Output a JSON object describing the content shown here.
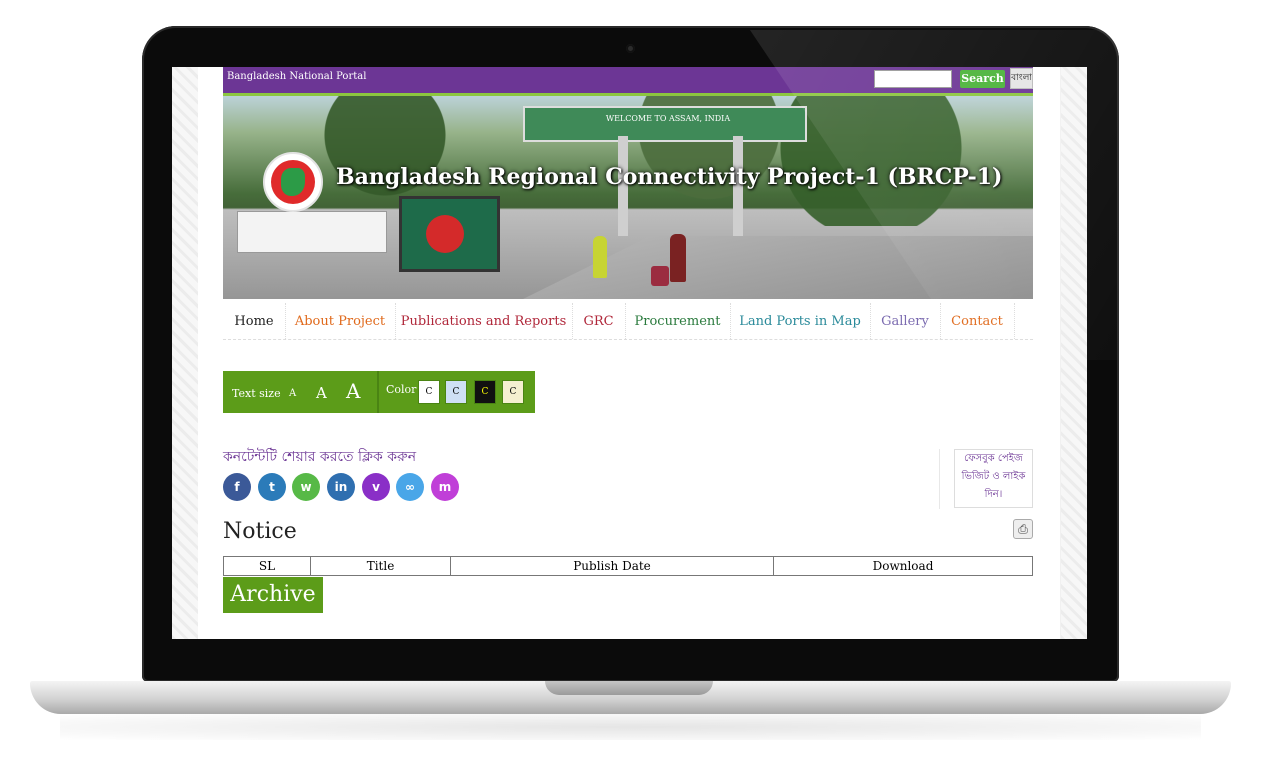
{
  "topbar": {
    "portal_label": "Bangladesh National Portal",
    "search_placeholder": "",
    "search_button": "Search",
    "lang_button": "বাংলা"
  },
  "banner": {
    "title": "Bangladesh Regional Connectivity Project-1 (BRCP-1)",
    "gate_text": "WELCOME TO ASSAM, INDIA"
  },
  "nav": {
    "items": [
      {
        "label": "Home",
        "color": "#222222"
      },
      {
        "label": "About Project",
        "color": "#e0691b"
      },
      {
        "label": "Publications and Reports",
        "color": "#b0273a"
      },
      {
        "label": "GRC",
        "color": "#b0273a"
      },
      {
        "label": "Procurement",
        "color": "#2a7a3d"
      },
      {
        "label": "Land Ports in Map",
        "color": "#2a8a9a"
      },
      {
        "label": "Gallery",
        "color": "#7b6bb0"
      },
      {
        "label": "Contact",
        "color": "#e0691b"
      }
    ]
  },
  "accessibility": {
    "text_size_label": "Text size",
    "size_small": "A",
    "size_medium": "A",
    "size_large": "A",
    "color_label": "Color",
    "swatches": [
      {
        "label": "C",
        "bg": "#ffffff",
        "fg": "#000000"
      },
      {
        "label": "C",
        "bg": "#cfe0f5",
        "fg": "#000000"
      },
      {
        "label": "C",
        "bg": "#111111",
        "fg": "#ffff00"
      },
      {
        "label": "C",
        "bg": "#f5f0d0",
        "fg": "#000000"
      }
    ]
  },
  "share": {
    "label": "কনটেন্টটি শেয়ার করতে ক্লিক করুন",
    "buttons": [
      {
        "icon": "facebook-icon",
        "glyph": "f",
        "color": "#3b5998"
      },
      {
        "icon": "twitter-icon",
        "glyph": "t",
        "color": "#2b7bb9"
      },
      {
        "icon": "whatsapp-icon",
        "glyph": "w",
        "color": "#57b947"
      },
      {
        "icon": "linkedin-icon",
        "glyph": "in",
        "color": "#2f6fb0"
      },
      {
        "icon": "viber-icon",
        "glyph": "v",
        "color": "#8a2fc7"
      },
      {
        "icon": "link-icon",
        "glyph": "∞",
        "color": "#49a6e8"
      },
      {
        "icon": "messenger-icon",
        "glyph": "m",
        "color": "#c03fd8"
      }
    ]
  },
  "facebook_box": {
    "line1": "ফেসবুক পেইজ",
    "line2": "ভিজিট ও লাইক",
    "line3": "দিন।"
  },
  "notice": {
    "heading": "Notice",
    "columns": [
      "SL",
      "Title",
      "Publish Date",
      "Download"
    ]
  },
  "archive_button": "Archive"
}
